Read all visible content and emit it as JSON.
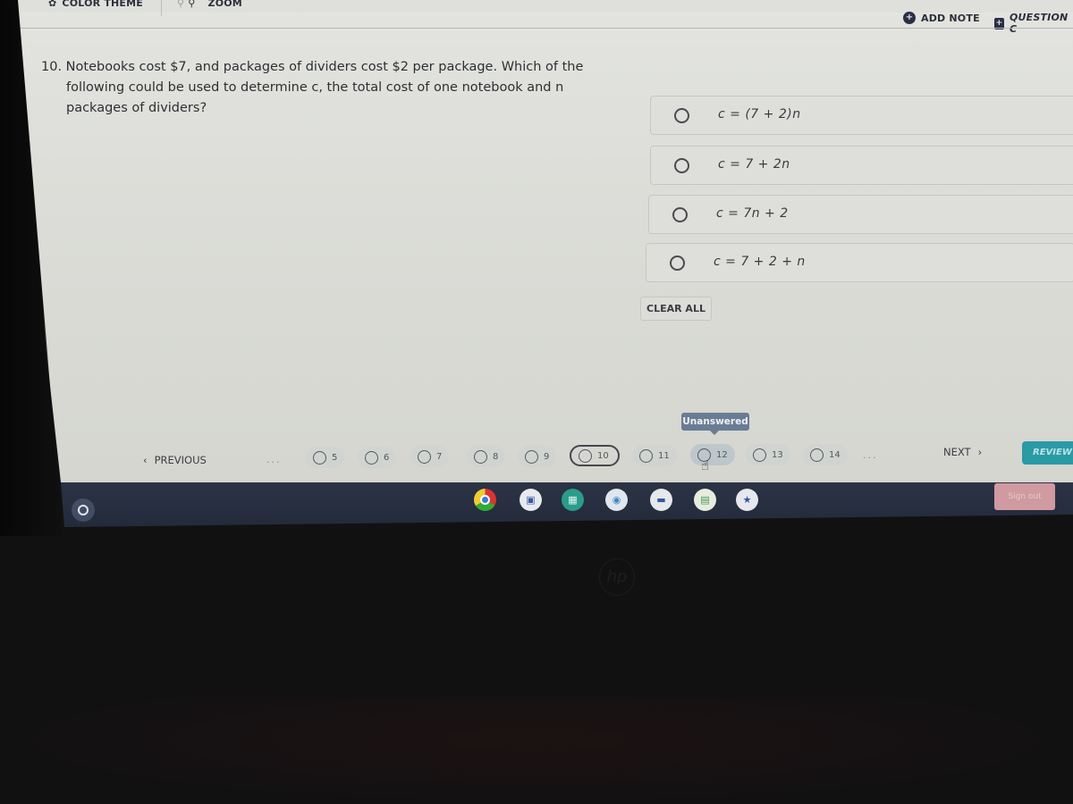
{
  "toolbar": {
    "color_theme_label": "COLOR THEME",
    "zoom_label": "ZOOM",
    "add_note_label": "ADD NOTE",
    "question_label": "QUESTION C"
  },
  "question": {
    "number": "10.",
    "line1": "Notebooks cost $7, and packages of dividers cost $2 per package. Which of the",
    "line2": "following could be used to determine c, the total cost of one notebook and n",
    "line3": "packages of dividers?"
  },
  "choices": [
    {
      "expr": "c = (7 + 2)n",
      "selected": false
    },
    {
      "expr": "c = 7 + 2n",
      "selected": false
    },
    {
      "expr": "c = 7n + 2",
      "selected": false
    },
    {
      "expr": "c = 7 + 2 + n",
      "selected": false
    }
  ],
  "clear_all_label": "CLEAR ALL",
  "navigation": {
    "previous_label": "PREVIOUS",
    "next_label": "NEXT",
    "review_label": "REVIEW",
    "ellipsis": "...",
    "tooltip": "Unanswered",
    "current_question": "10",
    "hovered_question": "12",
    "questions": [
      "5",
      "6",
      "7",
      "8",
      "9",
      "10",
      "11",
      "12",
      "13",
      "14"
    ]
  },
  "shelf": {
    "apps": [
      "chrome",
      "photos",
      "app-grid",
      "chat",
      "docs",
      "classroom",
      "texas-flag-app"
    ],
    "signout_label": "Sign out"
  },
  "colors": {
    "review_button": "#2a9aa5",
    "tooltip_bg": "#6a7c94",
    "signout_button": "#cf9aa0",
    "shelf_bg": "#2b3345"
  }
}
